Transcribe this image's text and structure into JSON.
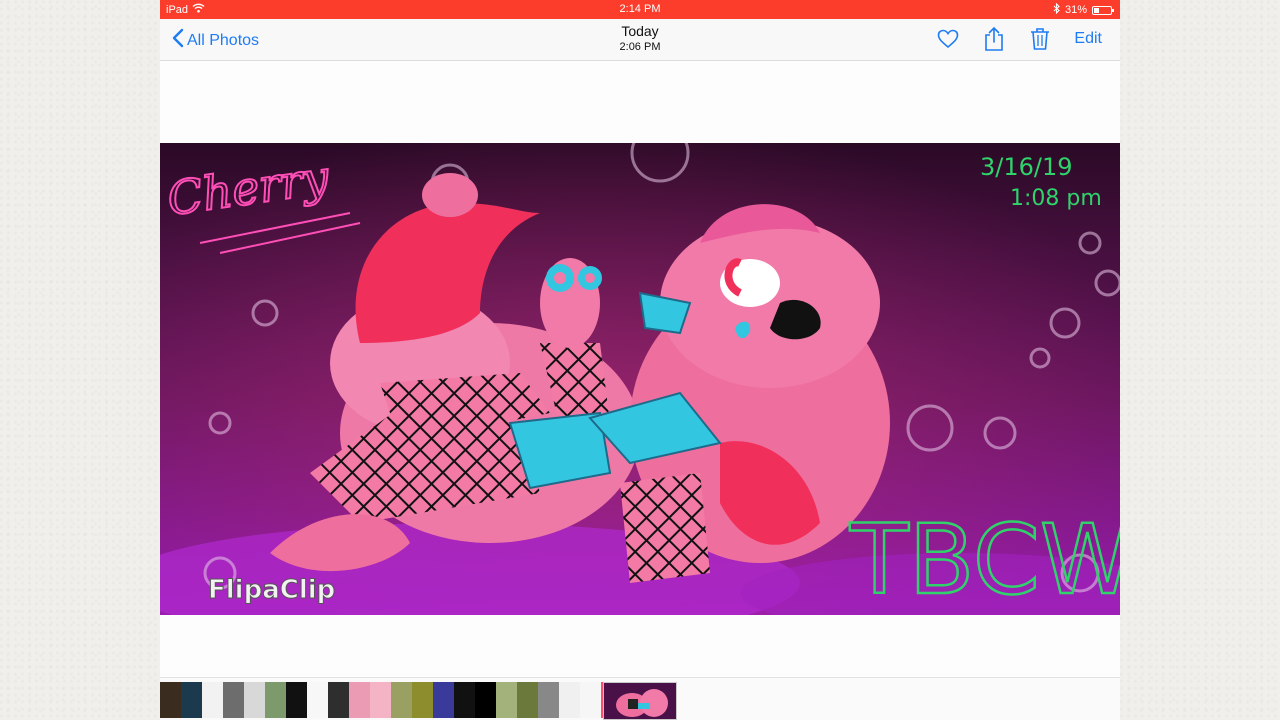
{
  "status_bar": {
    "device": "iPad",
    "time": "2:14 PM",
    "battery_percent": "31%",
    "battery_level": 0.31
  },
  "nav": {
    "back_label": "All Photos",
    "title": "Today",
    "subtitle": "2:06 PM",
    "edit_label": "Edit"
  },
  "artwork": {
    "signature_name": "Cherry",
    "date_line": "3/16/19",
    "time_line": "1:08 pm",
    "watermark": "FlipaClip",
    "artist_tag": "TBCW",
    "colors": {
      "background_top": "#2b0a26",
      "background_bottom": "#9a1cb0",
      "body_pink": "#ee6f9e",
      "accent_red": "#f0305a",
      "accent_cyan": "#33c6e0"
    }
  },
  "film_strip": {
    "thumbnail_colors": [
      "#3a2d1f",
      "#1b3a4d",
      "#f2f2f2",
      "#6d6d6d",
      "#d8d8d8",
      "#7c9a6b",
      "#111111",
      "#f7f7f7",
      "#2e2e2e",
      "#ec9bb5",
      "#f5b3c6",
      "#9aa062",
      "#8d8d2e",
      "#3a3a9a",
      "#111111",
      "#000000",
      "#a3b27a",
      "#6b7a3a",
      "#888888",
      "#f0f0f0",
      "#f6f6f6",
      "#ff4d6a"
    ],
    "selected_index": 22
  },
  "icons": {
    "back": "chevron-left-icon",
    "favorite": "heart-icon",
    "share": "share-icon",
    "delete": "trash-icon",
    "wifi": "wifi-icon",
    "bluetooth": "bluetooth-icon",
    "battery": "battery-icon"
  }
}
